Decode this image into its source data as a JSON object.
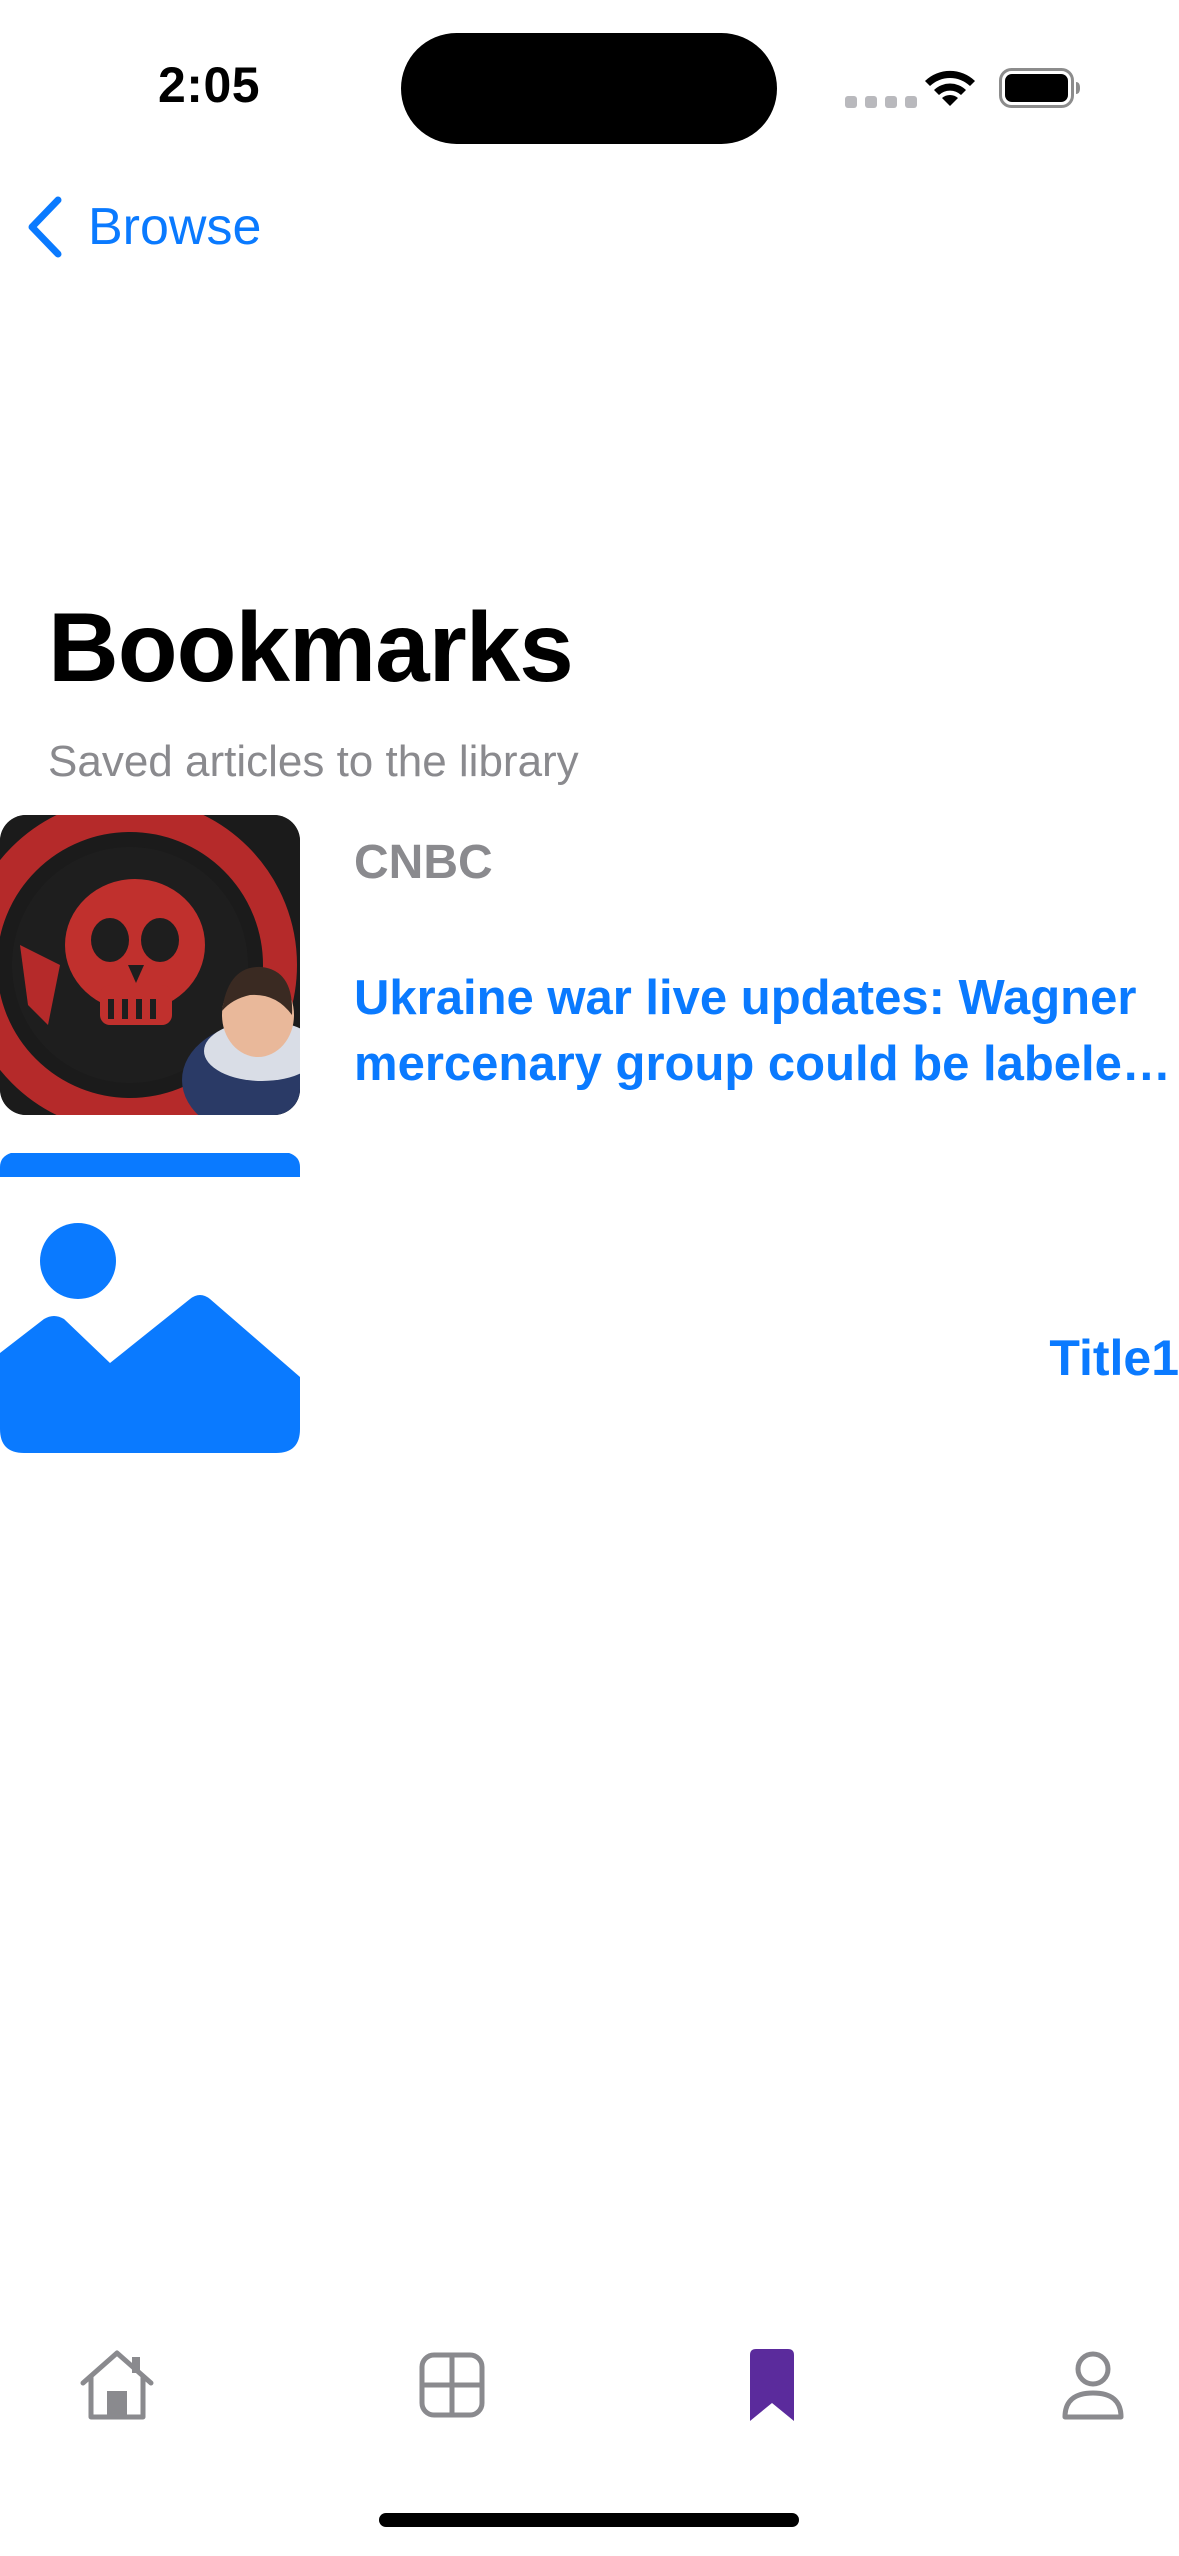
{
  "status_bar": {
    "time": "2:05"
  },
  "nav": {
    "back_label": "Browse",
    "back_icon": "chevron-left-icon"
  },
  "page": {
    "title": "Bookmarks",
    "subtitle": "Saved articles to the library"
  },
  "articles": [
    {
      "source": "CNBC",
      "title": "Ukraine war live updates: Wagner mercenary group could be labeled a terrorist organization",
      "image": "skull-mural-photo"
    },
    {
      "source": "",
      "title": "Title1",
      "image": "photo-placeholder-icon"
    }
  ],
  "tab_bar": {
    "items": [
      {
        "name": "home",
        "icon": "house-icon",
        "selected": false
      },
      {
        "name": "browse",
        "icon": "grid-icon",
        "selected": false
      },
      {
        "name": "bookmarks",
        "icon": "bookmark-icon",
        "selected": true
      },
      {
        "name": "profile",
        "icon": "person-icon",
        "selected": false
      }
    ]
  },
  "colors": {
    "accent": "#0a7aff",
    "tab_selected": "#5b2b9c",
    "tab_inactive": "#8a8a8e",
    "secondary_text": "#8a8a8e"
  }
}
